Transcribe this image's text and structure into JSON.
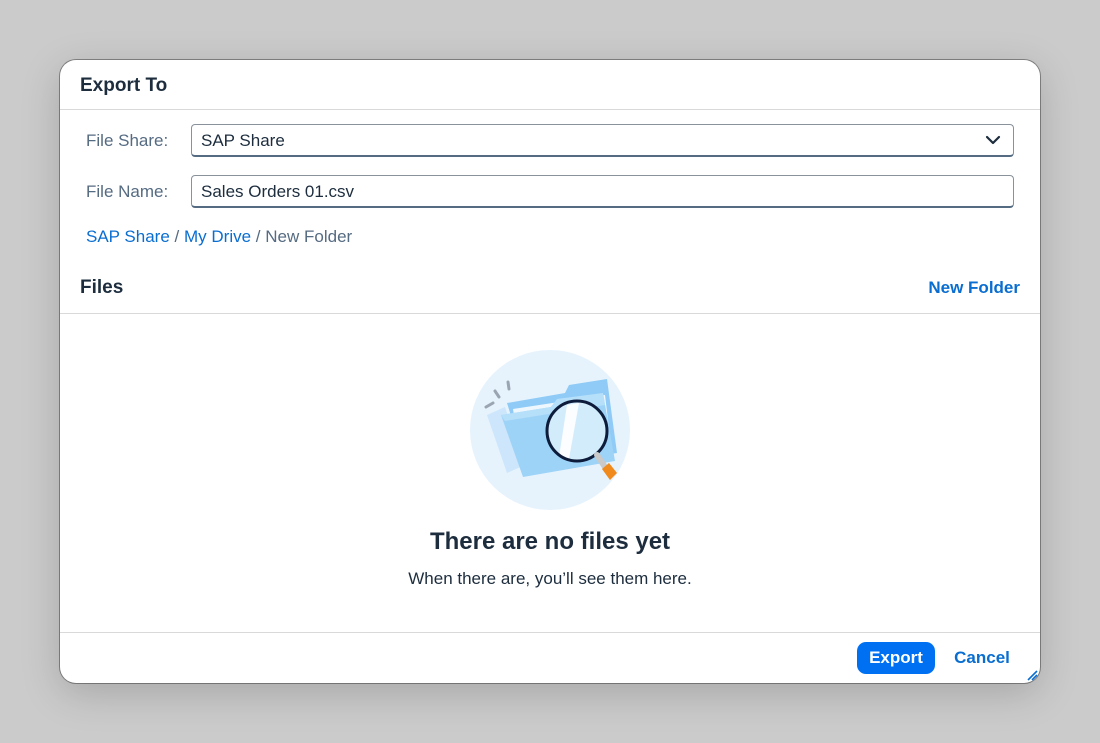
{
  "dialog": {
    "title": "Export To"
  },
  "form": {
    "file_share": {
      "label": "File Share:",
      "value": "SAP Share"
    },
    "file_name": {
      "label": "File Name:",
      "value": "Sales Orders 01.csv"
    }
  },
  "breadcrumb": {
    "items": [
      "SAP Share",
      "My Drive",
      "New Folder"
    ],
    "separator": "/"
  },
  "files": {
    "title": "Files",
    "new_folder_label": "New Folder"
  },
  "empty_state": {
    "title": "There are no files yet",
    "subtitle": "When there are, you’ll see them here."
  },
  "footer": {
    "export_label": "Export",
    "cancel_label": "Cancel"
  },
  "colors": {
    "accent": "#0070f2",
    "link": "#0a6ed1",
    "text": "#1d2d3e",
    "label": "#556b82"
  },
  "icons": {
    "dropdown": "chevron-down-icon",
    "illustration": "empty-folder-search-illustration",
    "resize": "resize-grip-icon"
  }
}
